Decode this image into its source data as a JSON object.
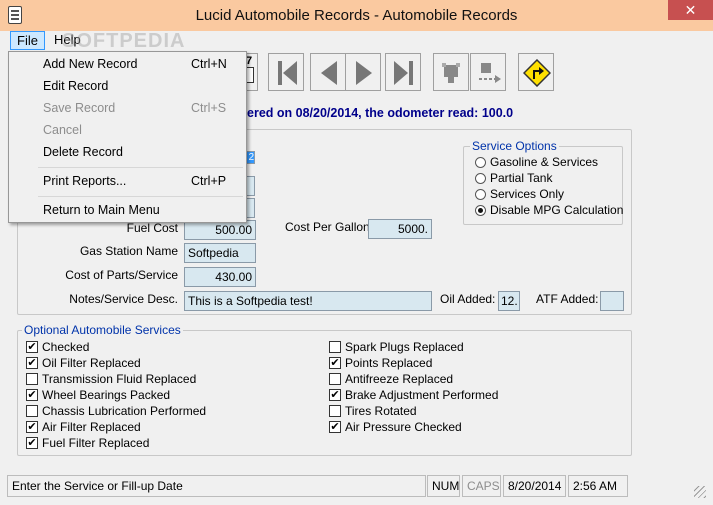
{
  "window": {
    "title": "Lucid Automobile Records - Automobile Records",
    "close_glyph": "✕"
  },
  "menubar": {
    "file": "File",
    "help": "Help"
  },
  "watermark": "SOFTPEDIA",
  "file_menu": {
    "items": [
      {
        "label": "Add New Record",
        "shortcut": "Ctrl+N",
        "enabled": true
      },
      {
        "label": "Edit Record",
        "shortcut": "",
        "enabled": true
      },
      {
        "label": "Save Record",
        "shortcut": "Ctrl+S",
        "enabled": false
      },
      {
        "label": "Cancel",
        "shortcut": "",
        "enabled": false
      },
      {
        "label": "Delete Record",
        "shortcut": "",
        "enabled": true
      },
      {
        "label": "Print Reports...",
        "shortcut": "Ctrl+P",
        "enabled": true
      },
      {
        "label": "Return to Main Menu",
        "shortcut": "",
        "enabled": true
      }
    ]
  },
  "toolbar": {
    "buttons": [
      "calendar-icon",
      "first-record-icon",
      "previous-record-icon",
      "next-record-icon",
      "last-record-icon",
      "goto-record-icon",
      "goto-next-icon",
      "exit-sign-icon"
    ],
    "calendar_digit": "7"
  },
  "odometer_text": "ered on 08/20/2014, the odometer read: 100.0",
  "form": {
    "fuel_cost_label": "Fuel Cost",
    "fuel_cost_value": "500.00",
    "cost_per_gallon_label": "Cost Per Gallon:",
    "cost_per_gallon_value": "5000.",
    "gas_station_label": "Gas Station Name",
    "gas_station_value": "Softpedia",
    "cost_parts_label": "Cost of Parts/Service",
    "cost_parts_value": "430.00",
    "notes_label": "Notes/Service Desc.",
    "notes_value": "This is a Softpedia test!",
    "oil_added_label": "Oil Added:",
    "oil_added_value": "12.",
    "atf_added_label": "ATF Added:",
    "atf_added_value": "",
    "partial_field_value": "2"
  },
  "service_options": {
    "title": "Service Options",
    "options": [
      {
        "label": "Gasoline & Services",
        "selected": false
      },
      {
        "label": "Partial Tank",
        "selected": false
      },
      {
        "label": "Services Only",
        "selected": false
      },
      {
        "label": "Disable MPG Calculation",
        "selected": true
      }
    ]
  },
  "optional_services": {
    "title": "Optional Automobile Services",
    "left": [
      {
        "label": "Checked",
        "checked": true
      },
      {
        "label": "Oil Filter Replaced",
        "checked": true
      },
      {
        "label": "Transmission Fluid Replaced",
        "checked": false
      },
      {
        "label": "Wheel Bearings Packed",
        "checked": true
      },
      {
        "label": "Chassis Lubrication Performed",
        "checked": false
      },
      {
        "label": "Air Filter Replaced",
        "checked": true
      },
      {
        "label": "Fuel Filter Replaced",
        "checked": true
      }
    ],
    "right": [
      {
        "label": "Spark Plugs Replaced",
        "checked": false
      },
      {
        "label": "Points Replaced",
        "checked": true
      },
      {
        "label": "Antifreeze Replaced",
        "checked": false
      },
      {
        "label": "Brake Adjustment Performed",
        "checked": true
      },
      {
        "label": "Tires Rotated",
        "checked": false
      },
      {
        "label": "Air Pressure Checked",
        "checked": true
      }
    ]
  },
  "statusbar": {
    "message": "Enter the Service or Fill-up Date",
    "num": "NUM",
    "caps": "CAPS",
    "date": "8/20/2014",
    "time": "2:56 AM"
  },
  "colors": {
    "title_bar": "#fac9a0",
    "close": "#c75050",
    "accent_text": "#00008b",
    "group_title": "#0033aa",
    "field_bg": "#d8e8f0"
  }
}
